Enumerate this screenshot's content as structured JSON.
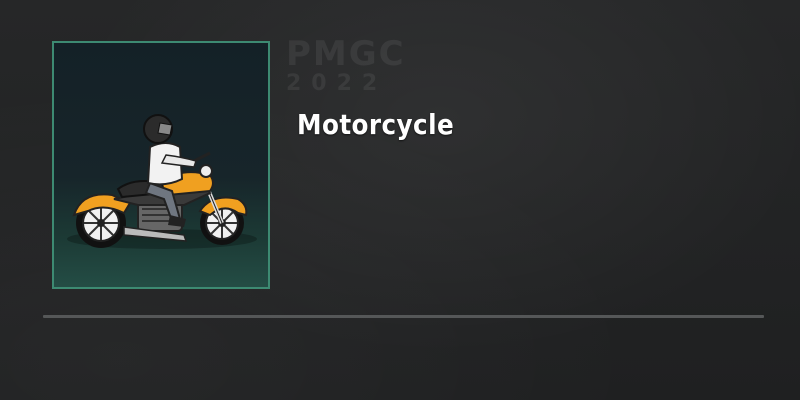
{
  "item": {
    "name": "Motorcycle",
    "icon": "motorcycle-rider-icon",
    "frame_color": "#3d8a72",
    "bike_color": "#f0a020"
  },
  "watermark": {
    "line1": "PMGC",
    "line2": "2022"
  }
}
